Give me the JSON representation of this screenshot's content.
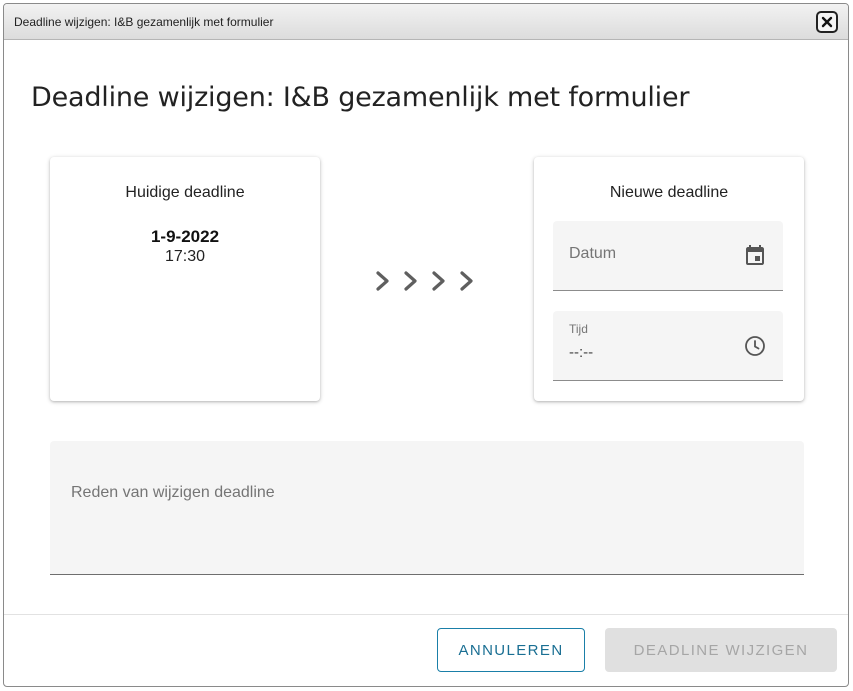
{
  "window": {
    "title": "Deadline wijzigen: I&B gezamenlijk met formulier"
  },
  "dialog": {
    "title": "Deadline wijzigen: I&B gezamenlijk met formulier"
  },
  "current_deadline": {
    "heading": "Huidige deadline",
    "date": "1-9-2022",
    "time": "17:30"
  },
  "new_deadline": {
    "heading": "Nieuwe deadline",
    "date_field": {
      "placeholder": "Datum",
      "icon": "calendar-icon"
    },
    "time_field": {
      "label": "Tijd",
      "value": "--:--",
      "icon": "clock-icon"
    }
  },
  "reason": {
    "placeholder": "Reden van wijzigen deadline"
  },
  "buttons": {
    "cancel": "ANNULEREN",
    "submit": "DEADLINE WIJZIGEN"
  },
  "colors": {
    "accent": "#1a7fa8",
    "field_bg": "#f5f5f5",
    "disabled_bg": "#e0e0e0",
    "disabled_text": "#a6a6a6",
    "arrow": "#5f5f5f"
  }
}
